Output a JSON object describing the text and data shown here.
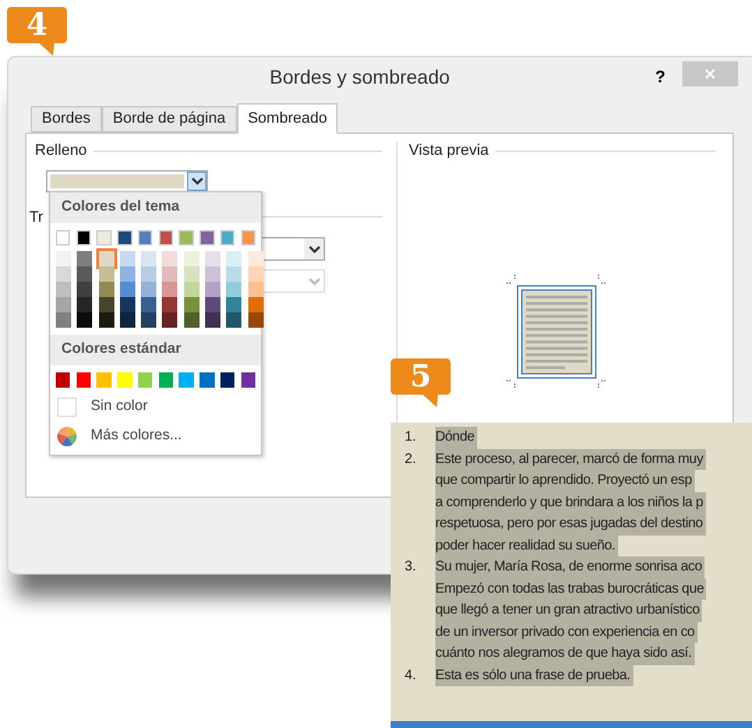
{
  "step_badges": [
    "4",
    "5"
  ],
  "window": {
    "title": "Bordes y sombreado",
    "help": "?"
  },
  "tabs": [
    {
      "label": "Bordes",
      "selected": false
    },
    {
      "label": "Borde de página",
      "selected": false
    },
    {
      "label": "Sombreado",
      "selected": true
    }
  ],
  "fill_group": {
    "label": "Relleno",
    "pattern_label": "Tr"
  },
  "pattern_combos": [
    {
      "disabled": false
    },
    {
      "disabled": true
    }
  ],
  "preview": {
    "label": "Vista previa"
  },
  "color_menu": {
    "theme_title": "Colores del tema",
    "standard_title": "Colores estándar",
    "theme_colors": [
      {
        "color": "#ffffff",
        "selected": false,
        "shades": [
          {
            "color": "#f2f2f2",
            "selected": false
          },
          {
            "color": "#d9d9d9",
            "selected": false
          },
          {
            "color": "#bfbfbf",
            "selected": false
          },
          {
            "color": "#a6a6a6",
            "selected": false
          },
          {
            "color": "#808080",
            "selected": false
          }
        ]
      },
      {
        "color": "#000000",
        "selected": false,
        "shades": [
          {
            "color": "#7f7f7f",
            "selected": false
          },
          {
            "color": "#595959",
            "selected": false
          },
          {
            "color": "#3f3f3f",
            "selected": false
          },
          {
            "color": "#262626",
            "selected": false
          },
          {
            "color": "#0c0c0c",
            "selected": false
          }
        ]
      },
      {
        "color": "#eeece1",
        "selected": false,
        "shades": [
          {
            "color": "#ddd9c3",
            "selected": true
          },
          {
            "color": "#c4bd97",
            "selected": false
          },
          {
            "color": "#938953",
            "selected": false
          },
          {
            "color": "#494429",
            "selected": false
          },
          {
            "color": "#1d1b10",
            "selected": false
          }
        ]
      },
      {
        "color": "#1f497d",
        "selected": false,
        "shades": [
          {
            "color": "#c6d9f0",
            "selected": false
          },
          {
            "color": "#8db3e2",
            "selected": false
          },
          {
            "color": "#548dd4",
            "selected": false
          },
          {
            "color": "#17365d",
            "selected": false
          },
          {
            "color": "#0f243e",
            "selected": false
          }
        ]
      },
      {
        "color": "#4f81bd",
        "selected": false,
        "shades": [
          {
            "color": "#dbe5f1",
            "selected": false
          },
          {
            "color": "#b8cce4",
            "selected": false
          },
          {
            "color": "#95b3d7",
            "selected": false
          },
          {
            "color": "#366092",
            "selected": false
          },
          {
            "color": "#244061",
            "selected": false
          }
        ]
      },
      {
        "color": "#c0504d",
        "selected": false,
        "shades": [
          {
            "color": "#f2dcdb",
            "selected": false
          },
          {
            "color": "#e5b9b7",
            "selected": false
          },
          {
            "color": "#d99694",
            "selected": false
          },
          {
            "color": "#953734",
            "selected": false
          },
          {
            "color": "#632423",
            "selected": false
          }
        ]
      },
      {
        "color": "#9bbb59",
        "selected": false,
        "shades": [
          {
            "color": "#ebf1dd",
            "selected": false
          },
          {
            "color": "#d7e3bc",
            "selected": false
          },
          {
            "color": "#c3d69b",
            "selected": false
          },
          {
            "color": "#76923c",
            "selected": false
          },
          {
            "color": "#4f6128",
            "selected": false
          }
        ]
      },
      {
        "color": "#8064a2",
        "selected": false,
        "shades": [
          {
            "color": "#e5e0ec",
            "selected": false
          },
          {
            "color": "#ccc1d9",
            "selected": false
          },
          {
            "color": "#b2a2c7",
            "selected": false
          },
          {
            "color": "#5f497a",
            "selected": false
          },
          {
            "color": "#3f3151",
            "selected": false
          }
        ]
      },
      {
        "color": "#4bacc6",
        "selected": false,
        "shades": [
          {
            "color": "#dbeef3",
            "selected": false
          },
          {
            "color": "#b7dde8",
            "selected": false
          },
          {
            "color": "#92cddc",
            "selected": false
          },
          {
            "color": "#31859b",
            "selected": false
          },
          {
            "color": "#205867",
            "selected": false
          }
        ]
      },
      {
        "color": "#f79646",
        "selected": false,
        "shades": [
          {
            "color": "#fdeada",
            "selected": false
          },
          {
            "color": "#fbd5b5",
            "selected": false
          },
          {
            "color": "#fac08f",
            "selected": false
          },
          {
            "color": "#e36c09",
            "selected": false
          },
          {
            "color": "#974806",
            "selected": false
          }
        ]
      }
    ],
    "standard_colors": [
      {
        "color": "#c00000",
        "selected": false
      },
      {
        "color": "#ff0000",
        "selected": false
      },
      {
        "color": "#ffc000",
        "selected": false
      },
      {
        "color": "#ffff00",
        "selected": false
      },
      {
        "color": "#92d050",
        "selected": false
      },
      {
        "color": "#00b050",
        "selected": false
      },
      {
        "color": "#00b0f0",
        "selected": false
      },
      {
        "color": "#0070c0",
        "selected": false
      },
      {
        "color": "#002060",
        "selected": false
      },
      {
        "color": "#7030a0",
        "selected": false
      }
    ],
    "no_color": "Sin color",
    "more_colors": "Más colores..."
  },
  "document": {
    "items": [
      {
        "number": "1.",
        "lines": [
          "Dónde"
        ]
      },
      {
        "number": "2.",
        "lines": [
          "Este proceso, al parecer, marcó de forma muy",
          "que compartir lo aprendido. Proyectó un esp",
          "a comprenderlo y que brindara a los niños la p",
          "respetuosa, pero por esas jugadas del destino",
          "poder hacer realidad su sueño."
        ]
      },
      {
        "number": "3.",
        "lines": [
          "Su mujer, María Rosa, de enorme sonrisa aco",
          "Empezó con todas las trabas burocráticas que",
          "que llegó a tener un gran atractivo urbanístico",
          "de un inversor privado con experiencia en co",
          "cuánto nos alegramos de que haya sido así."
        ]
      },
      {
        "number": "4.",
        "lines": [
          "Esta es sólo una frase de prueba."
        ]
      }
    ]
  }
}
